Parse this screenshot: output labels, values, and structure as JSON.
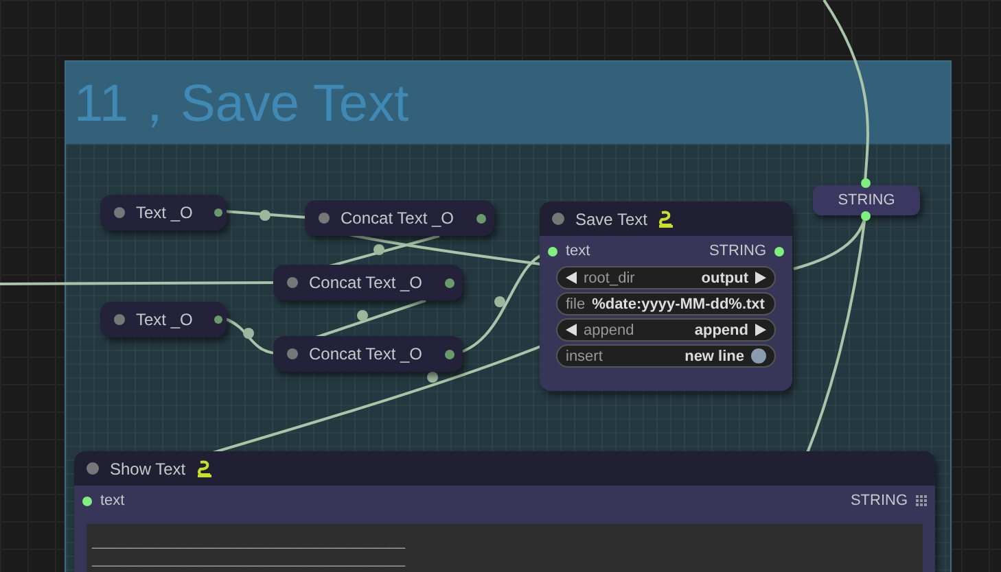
{
  "group": {
    "title": "11，Save Text"
  },
  "nodes": [
    {
      "kind": "source",
      "title": "Text _O"
    },
    {
      "kind": "concat",
      "title": "Concat Text _O"
    },
    {
      "kind": "concat",
      "title": "Concat Text _O"
    },
    {
      "kind": "source",
      "title": "Text _O"
    },
    {
      "kind": "concat",
      "title": "Concat Text _O"
    }
  ],
  "save_text": {
    "title": "Save Text",
    "input": "text",
    "output": "STRING",
    "widgets": [
      {
        "kind": "combo",
        "label": "root_dir",
        "value": "output"
      },
      {
        "kind": "text",
        "label": "file",
        "value": "%date:yyyy-MM-dd%.txt"
      },
      {
        "kind": "combo",
        "label": "append",
        "value": "append"
      },
      {
        "kind": "toggle",
        "label": "insert",
        "value": "new line",
        "on": true
      }
    ]
  },
  "string_node": {
    "title": "STRING"
  },
  "show_text": {
    "title": "Show Text",
    "input": "text",
    "output": "STRING",
    "lines": [
      "_________________________________________",
      "_________________________________________"
    ]
  }
}
